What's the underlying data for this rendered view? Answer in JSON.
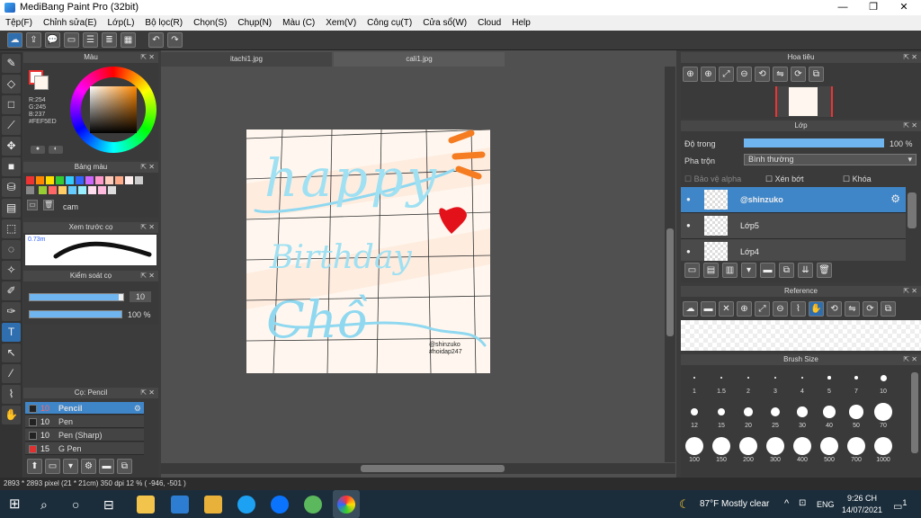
{
  "window": {
    "title": "MediBang Paint Pro (32bit)",
    "minimize": "—",
    "maximize": "❐",
    "close": "✕"
  },
  "menu": [
    "Tệp(F)",
    "Chỉnh sửa(E)",
    "Lớp(L)",
    "Bộ lọc(R)",
    "Chọn(S)",
    "Chụp(N)",
    "Màu (C)",
    "Xem(V)",
    "Công cụ(T)",
    "Cửa sổ(W)",
    "Cloud",
    "Help"
  ],
  "color_panel": {
    "title": "Màu",
    "rgb": [
      "R:254",
      "G:245",
      "B:237"
    ],
    "hex": "#FEF5ED"
  },
  "palette_panel": {
    "title": "Bảng màu",
    "name": "cam"
  },
  "brush_preview": {
    "title": "Xem trước cọ",
    "size": "0.73m"
  },
  "brush_control": {
    "title": "Kiểm soát cọ",
    "size_value": "10",
    "opacity_value": "100 %",
    "opacity_fraction": 1.0,
    "size_fraction": 0.95
  },
  "brush_list": {
    "title": "Cọ: Pencil",
    "items": [
      {
        "size": "10",
        "name": "Pencil",
        "selected": true,
        "color": "#222222"
      },
      {
        "size": "10",
        "name": "Pen",
        "selected": false,
        "color": "#222222"
      },
      {
        "size": "10",
        "name": "Pen (Sharp)",
        "selected": false,
        "color": "#222222"
      },
      {
        "size": "15",
        "name": "G Pen",
        "selected": false,
        "color": "#e03030"
      }
    ]
  },
  "tabs": [
    "itachi1.jpg",
    "cali1.jpg"
  ],
  "artwork": {
    "line1": "happy",
    "line2": "Birthday",
    "line3": "Chồ",
    "credit1": "@shinzuko",
    "credit2": "#hoidap247"
  },
  "navigator": {
    "title": "Hoa tiêu"
  },
  "layers_panel": {
    "title": "Lớp",
    "opacity_label": "Độ trong",
    "opacity_value": "100 %",
    "opacity_fraction": 1.0,
    "blend_label": "Pha trộn",
    "blend_value": "Bình thường",
    "protect_alpha": "Bảo vệ alpha",
    "clipping": "Xén bớt",
    "lock": "Khóa",
    "layers": [
      {
        "name": "@shinzuko",
        "selected": true
      },
      {
        "name": "Lớp5",
        "selected": false
      },
      {
        "name": "Lớp4",
        "selected": false
      }
    ]
  },
  "reference": {
    "title": "Reference"
  },
  "brush_size": {
    "title": "Brush Size",
    "rows": [
      [
        "1",
        "1.5",
        "2",
        "3",
        "4",
        "5",
        "7",
        "10"
      ],
      [
        "12",
        "15",
        "20",
        "25",
        "30",
        "40",
        "50",
        "70"
      ],
      [
        "100",
        "150",
        "200",
        "300",
        "400",
        "500",
        "700",
        "1000"
      ]
    ]
  },
  "status": "2893 * 2893 pixel  (21 * 21cm)  350 dpi  12 %  ( -946, -501 )",
  "taskbar": {
    "weather": "87°F  Mostly clear",
    "lang": "ENG",
    "time": "9:26 CH",
    "date": "14/07/2021",
    "notif": "1"
  }
}
